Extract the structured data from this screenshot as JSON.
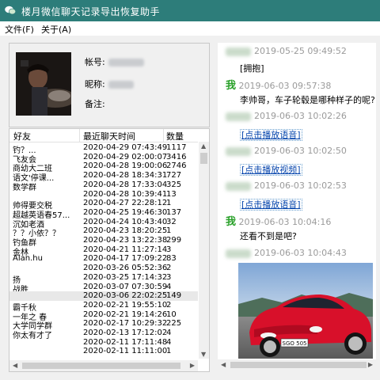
{
  "window": {
    "title": "楼月微信聊天记录导出恢复助手",
    "accent_color": "#2d7d7a"
  },
  "menu": {
    "file": "文件(F)",
    "about": "关于(A)"
  },
  "profile": {
    "account_label": "帐号:",
    "nickname_label": "昵称:",
    "remark_label": "备注:",
    "remark_value": ""
  },
  "friends_table": {
    "columns": [
      "好友",
      "最近聊天时间",
      "数量"
    ],
    "rows": [
      {
        "name": "钓？...",
        "time": "2020-04-29 07:43:49",
        "count": "1117"
      },
      {
        "name": "飞友会",
        "time": "2020-04-29 02:00:07",
        "count": "3416"
      },
      {
        "name": "商幼大二班",
        "time": "2020-04-28 19:00:06",
        "count": "2746"
      },
      {
        "name": "语文'停课...",
        "time": "2020-04-28 18:34:31",
        "count": "727"
      },
      {
        "name": "数学群",
        "time": "2020-04-28 17:33:04",
        "count": "325"
      },
      {
        "name": "",
        "time": "2020-04-28 10:39:41",
        "count": "13"
      },
      {
        "name": "帅得要交税",
        "time": "2020-04-27 22:28:12",
        "count": "1"
      },
      {
        "name": "超越英语春57...",
        "time": "2020-04-25 19:46:30",
        "count": "137"
      },
      {
        "name": "沉如老酒",
        "time": "2020-04-24 10:43:40",
        "count": "32"
      },
      {
        "name": "？？小依？？",
        "time": "2020-04-23 18:20:25",
        "count": "1"
      },
      {
        "name": "钓鱼群",
        "time": "2020-04-23 13:22:38",
        "count": "299"
      },
      {
        "name": "金林",
        "time": "2020-04-21 11:27:14",
        "count": "3"
      },
      {
        "name": "Alan.hu",
        "time": "2020-04-17 17:09:22",
        "count": "83"
      },
      {
        "name": "",
        "time": "2020-03-26 05:52:36",
        "count": "2"
      },
      {
        "name": "扬",
        "time": "2020-03-25 17:14:32",
        "count": "3"
      },
      {
        "name": "战胜",
        "time": "2020-03-07 07:30:59",
        "count": "4"
      },
      {
        "name": "",
        "time": "2020-03-06 22:02:25",
        "count": "149"
      },
      {
        "name": "霸千秋",
        "time": "2020-02-21 19:55:10",
        "count": "2"
      },
      {
        "name": "一年之 春",
        "time": "2020-02-21 19:14:26",
        "count": "10"
      },
      {
        "name": "大学同学群",
        "time": "2020-02-17 10:29:32",
        "count": "225"
      },
      {
        "name": "你太有才了",
        "time": "2020-02-13 17:12:02",
        "count": "4"
      },
      {
        "name": "",
        "time": "2020-02-11 17:11:48",
        "count": "4"
      },
      {
        "name": "",
        "time": "2020-02-11 11:11:00",
        "count": "1"
      }
    ]
  },
  "chat": {
    "me_label": "我",
    "messages": [
      {
        "sender": "other",
        "time": "2019-05-25 09:49:52",
        "text": "[拥抱]",
        "kind": "text"
      },
      {
        "sender": "me",
        "time": "2019-06-03 09:57:38",
        "text": "李帅哥，车子轮毂是哪种样子的呢?",
        "kind": "text"
      },
      {
        "sender": "other",
        "time": "2019-06-03 10:02:26",
        "text": "[点击播放语音]",
        "kind": "link"
      },
      {
        "sender": "other",
        "time": "2019-06-03 10:02:50",
        "text": "[点击播放视频]",
        "kind": "link"
      },
      {
        "sender": "other",
        "time": "2019-06-03 10:02:53",
        "text": "[点击播放语音]",
        "kind": "link"
      },
      {
        "sender": "me",
        "time": "2019-06-03 10:04:16",
        "text": "还看不到是吧?",
        "kind": "text"
      },
      {
        "sender": "other",
        "time": "2019-06-03 10:04:43",
        "text": "",
        "kind": "image"
      }
    ],
    "image_plate_text": "SGO 505"
  }
}
